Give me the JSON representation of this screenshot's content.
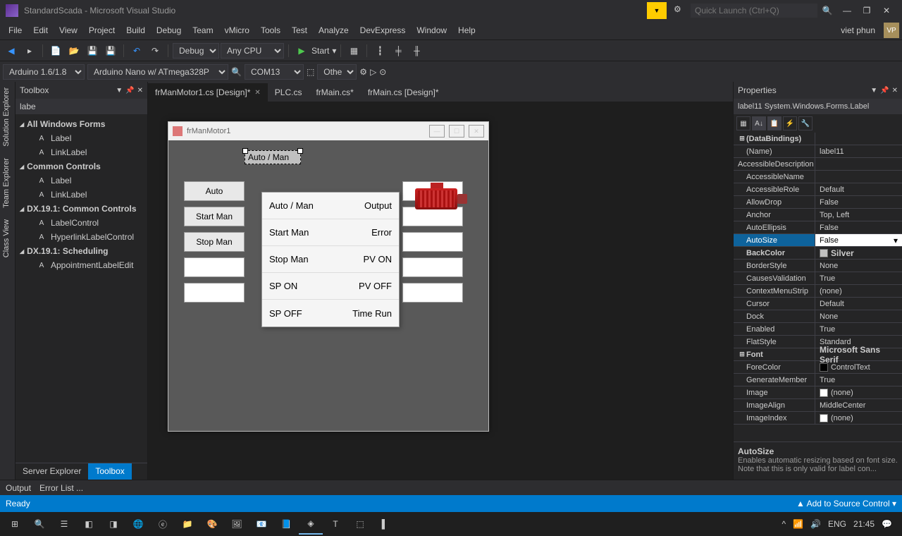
{
  "title": "StandardScada - Microsoft Visual Studio",
  "quicklaunch_placeholder": "Quick Launch (Ctrl+Q)",
  "user": {
    "name": "viet phun",
    "initials": "VP"
  },
  "menu": [
    "File",
    "Edit",
    "View",
    "Project",
    "Build",
    "Debug",
    "Team",
    "vMicro",
    "Tools",
    "Test",
    "Analyze",
    "DevExpress",
    "Window",
    "Help"
  ],
  "toolbar1": {
    "config": "Debug",
    "platform": "Any CPU",
    "start": "Start"
  },
  "toolbar2": {
    "board": "Arduino 1.6/1.8",
    "device": "Arduino Nano w/ ATmega328P",
    "port": "COM13",
    "other": "Other"
  },
  "vtabs": [
    "Solution Explorer",
    "Team Explorer",
    "Class View"
  ],
  "toolbox": {
    "title": "Toolbox",
    "search": "labe",
    "groups": [
      {
        "name": "All Windows Forms",
        "items": [
          "Label",
          "LinkLabel"
        ]
      },
      {
        "name": "Common Controls",
        "items": [
          "Label",
          "LinkLabel"
        ]
      },
      {
        "name": "DX.19.1: Common Controls",
        "items": [
          "LabelControl",
          "HyperlinkLabelControl"
        ]
      },
      {
        "name": "DX.19.1: Scheduling",
        "items": [
          "AppointmentLabelEdit"
        ]
      }
    ],
    "tabs": [
      "Server Explorer",
      "Toolbox"
    ]
  },
  "docs": [
    {
      "name": "frManMotor1.cs [Design]*",
      "active": true,
      "close": true
    },
    {
      "name": "PLC.cs"
    },
    {
      "name": "frMain.cs*"
    },
    {
      "name": "frMain.cs [Design]*"
    }
  ],
  "form": {
    "title": "frManMotor1",
    "selected": "Auto / Man",
    "buttons": [
      "Auto",
      "Start Man",
      "Stop Man"
    ],
    "dropdown": [
      {
        "l": "Auto / Man",
        "r": "Output"
      },
      {
        "l": "Start Man",
        "r": "Error"
      },
      {
        "l": "Stop Man",
        "r": "PV ON"
      },
      {
        "l": "SP ON",
        "r": "PV OFF"
      },
      {
        "l": "SP OFF",
        "r": "Time Run"
      }
    ]
  },
  "props": {
    "title": "Properties",
    "obj": "label11  System.Windows.Forms.Label",
    "rows": [
      {
        "k": "(DataBindings)",
        "v": "",
        "exp": "⊞",
        "bold": true
      },
      {
        "k": "(Name)",
        "v": "label11"
      },
      {
        "k": "AccessibleDescription",
        "v": ""
      },
      {
        "k": "AccessibleName",
        "v": ""
      },
      {
        "k": "AccessibleRole",
        "v": "Default"
      },
      {
        "k": "AllowDrop",
        "v": "False"
      },
      {
        "k": "Anchor",
        "v": "Top, Left"
      },
      {
        "k": "AutoEllipsis",
        "v": "False"
      },
      {
        "k": "AutoSize",
        "v": "False",
        "sel": true
      },
      {
        "k": "BackColor",
        "v": "Silver",
        "swatch": "#c0c0c0",
        "bold": true
      },
      {
        "k": "BorderStyle",
        "v": "None"
      },
      {
        "k": "CausesValidation",
        "v": "True"
      },
      {
        "k": "ContextMenuStrip",
        "v": "(none)"
      },
      {
        "k": "Cursor",
        "v": "Default"
      },
      {
        "k": "Dock",
        "v": "None"
      },
      {
        "k": "Enabled",
        "v": "True"
      },
      {
        "k": "FlatStyle",
        "v": "Standard"
      },
      {
        "k": "Font",
        "v": "Microsoft Sans Serif",
        "exp": "⊞",
        "bold": true
      },
      {
        "k": "ForeColor",
        "v": "ControlText",
        "swatch": "#000"
      },
      {
        "k": "GenerateMember",
        "v": "True"
      },
      {
        "k": "Image",
        "v": "(none)",
        "swatch": "#fff"
      },
      {
        "k": "ImageAlign",
        "v": "MiddleCenter"
      },
      {
        "k": "ImageIndex",
        "v": "(none)",
        "swatch": "#fff"
      }
    ],
    "desc": {
      "t": "AutoSize",
      "d": "Enables automatic resizing based on font size. Note that this is only valid for label con..."
    }
  },
  "outbar": [
    "Output",
    "Error List ..."
  ],
  "status": {
    "ready": "Ready",
    "source": "Add to Source Control"
  },
  "tray": {
    "lang": "ENG",
    "time": "21:45"
  }
}
